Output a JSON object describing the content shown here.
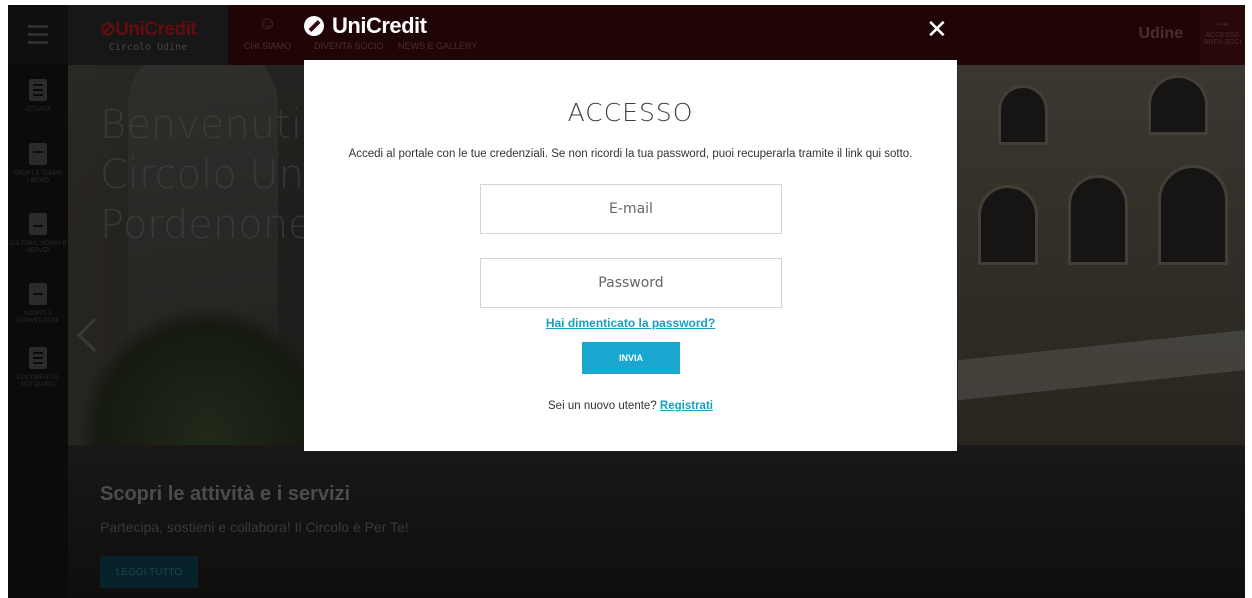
{
  "header": {
    "brand": "UniCredit",
    "brand_sub": "Circolo Udine",
    "nav": [
      {
        "label": "CHI SIAMO",
        "icon": "people-icon"
      },
      {
        "label": "DIVENTA SOCIO",
        "icon": "person-icon"
      },
      {
        "label": "NEWS E GALLERY",
        "icon": "news-icon"
      }
    ],
    "city": "Udine",
    "area_soci": [
      "ACCESSO",
      "AREA SOCI"
    ]
  },
  "sidebar": {
    "items": [
      {
        "label": "ATTIVITÀ",
        "icon": "list-icon"
      },
      {
        "label": "SPORT E TEMPO LIBERO",
        "icon": "sport-icon"
      },
      {
        "label": "CULTURA, HOBBY E SERVIZI",
        "icon": "people-icon"
      },
      {
        "label": "SCONTI E CONVENZIONI",
        "icon": "discount-icon"
      },
      {
        "label": "DOCUMENTI E NOTIZIARIO",
        "icon": "document-icon"
      }
    ]
  },
  "hero": {
    "title_lines": [
      "Benvenuti",
      "Circolo Uni",
      "Pordenone"
    ],
    "subtitle": "Scopri le attività e i servizi",
    "text": "Partecipa, sostieni e collabora! Il Circolo è Per Te!",
    "button": "LEGGI TUTTO"
  },
  "modal": {
    "brand": "UniCredit",
    "title": "ACCESSO",
    "description": "Accedi al portale con le tue credenziali. Se non ricordi la tua password, puoi recuperarla tramite il link qui sotto.",
    "email_placeholder": "E-mail",
    "password_placeholder": "Password",
    "forgot_link": "Hai dimenticato la password?",
    "submit": "INVIA",
    "new_user_text": "Sei un nuovo utente?",
    "register_link": "Registrati",
    "close": "✕"
  },
  "colors": {
    "topbar": "#3b0a0d",
    "accent": "#1aa8d0",
    "brand_red": "#b3171c"
  }
}
